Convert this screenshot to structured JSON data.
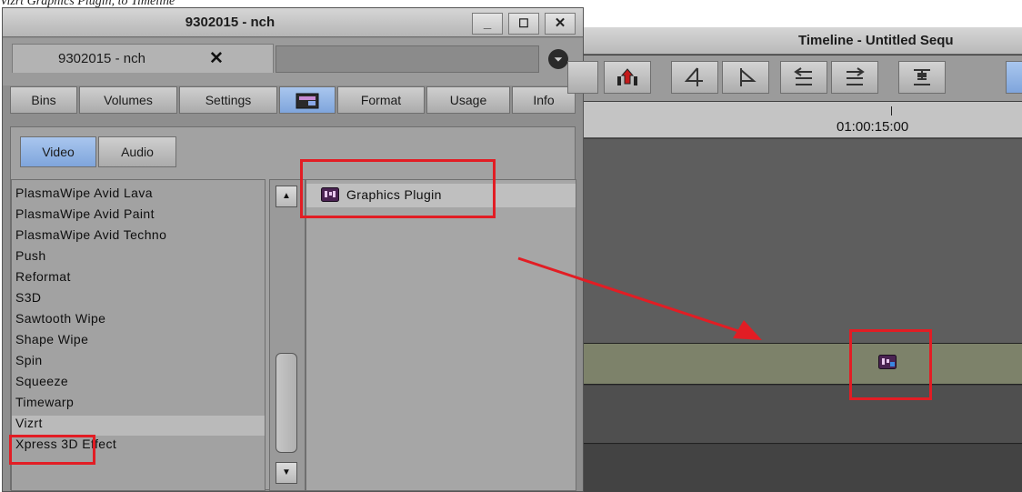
{
  "caption": "Vizrt Graphics Plugin, to Timeline",
  "project_window": {
    "title": "9302015 - nch",
    "controls": {
      "minimize": "_",
      "maximize": "☐",
      "close": "✕"
    },
    "tab": {
      "label": "9302015 - nch",
      "close": "✕"
    },
    "menu_icon": "⏷",
    "nav": [
      {
        "label": "Bins"
      },
      {
        "label": "Volumes"
      },
      {
        "label": "Settings"
      },
      {
        "label": ""
      },
      {
        "label": "Format"
      },
      {
        "label": "Usage"
      },
      {
        "label": "Info"
      }
    ],
    "video_audio": [
      {
        "label": "Video"
      },
      {
        "label": "Audio"
      }
    ],
    "effects": [
      "PlasmaWipe Avid Lava",
      "PlasmaWipe Avid Paint",
      "PlasmaWipe Avid Techno",
      "Push",
      "Reformat",
      "S3D",
      "Sawtooth Wipe",
      "Shape Wipe",
      "Spin",
      "Squeeze",
      "Timewarp",
      "Vizrt",
      "Xpress 3D Effect"
    ],
    "selected_effect": "Vizrt",
    "plugin_item": "Graphics Plugin"
  },
  "timeline": {
    "title": "Timeline - Untitled Sequ",
    "timecode": "01:00:15:00",
    "toolbar_icons": [
      "lift-icon",
      "mark-in-icon",
      "mark-out-icon",
      "extract-icon",
      "overwrite-icon",
      "splice-icon"
    ]
  },
  "colors": {
    "highlight": "#e21d24",
    "active_button": "#7fa5dc",
    "video_track": "#7d826a"
  }
}
